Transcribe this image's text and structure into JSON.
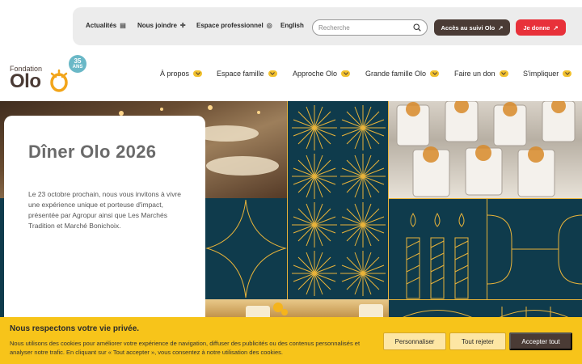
{
  "utility": {
    "links": [
      {
        "label": "Actualités",
        "icon": "newspaper-icon"
      },
      {
        "label": "Nous joindre",
        "icon": "pin-icon"
      },
      {
        "label": "Espace professionnel",
        "icon": "target-icon"
      },
      {
        "label": "English"
      }
    ],
    "search_placeholder": "Recherche",
    "suivi_label": "Accès au suivi Olo",
    "donate_label": "Je donne"
  },
  "logo": {
    "fondation": "Fondation",
    "name": "Olo",
    "badge_number": "35",
    "badge_text": "ANS"
  },
  "nav": [
    {
      "label": "À propos"
    },
    {
      "label": "Espace famille"
    },
    {
      "label": "Approche Olo"
    },
    {
      "label": "Grande famille Olo"
    },
    {
      "label": "Faire un don"
    },
    {
      "label": "S'impliquer"
    }
  ],
  "hero": {
    "title": "Dîner Olo 2026",
    "text": "Le 23 octobre prochain, nous vous invitons à vivre une expérience unique et porteuse d'impact, présentée par Agropur ainsi que Les Marchés Tradition et Marché Bonichoix."
  },
  "cookie": {
    "title": "Nous respectons votre vie privée.",
    "text": "Nous utilisons des cookies pour améliorer votre expérience de navigation, diffuser des publicités ou des contenus personnalisés et analyser notre trafic. En cliquant sur « Tout accepter », vous consentez à notre utilisation des cookies.",
    "personalize": "Personnaliser",
    "reject": "Tout rejeter",
    "accept": "Accepter tout"
  },
  "colors": {
    "accent_yellow": "#f2c12e",
    "brand_brown": "#4a3b35",
    "donate_red": "#e8313a",
    "hero_navy": "#0f3b4c"
  }
}
